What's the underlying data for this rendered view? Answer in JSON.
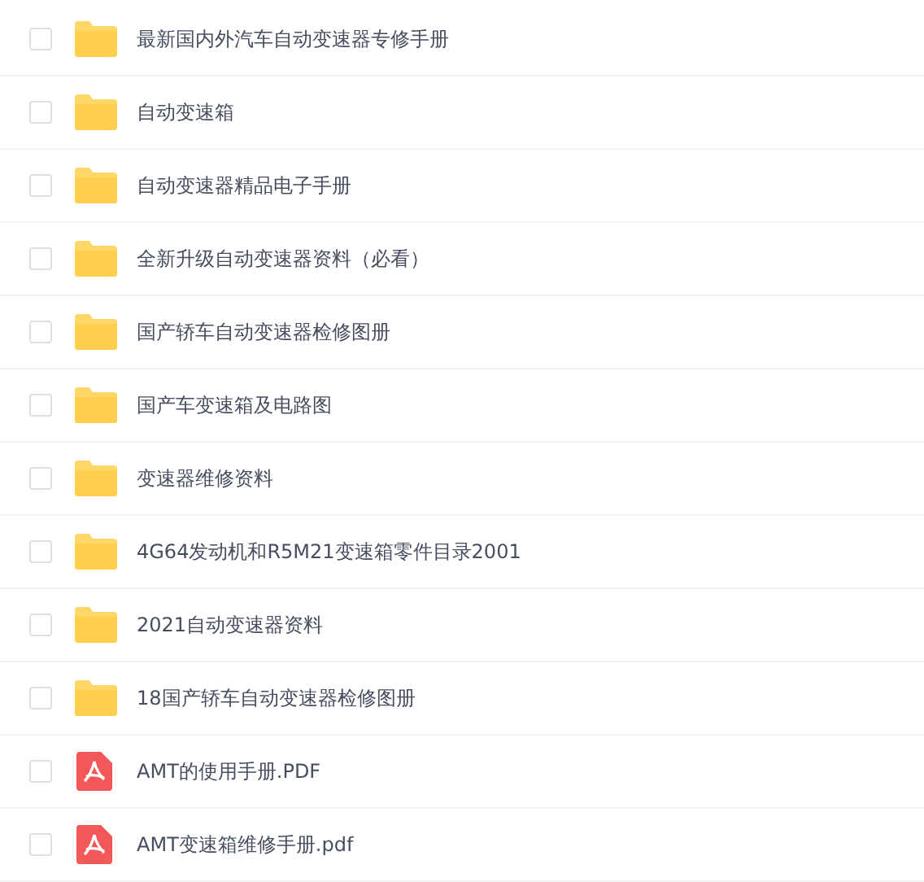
{
  "files": [
    {
      "kind": "folder",
      "name": "最新国内外汽车自动变速器专修手册",
      "checked": false
    },
    {
      "kind": "folder",
      "name": "自动变速箱",
      "checked": false
    },
    {
      "kind": "folder",
      "name": "自动变速器精品电子手册",
      "checked": false
    },
    {
      "kind": "folder",
      "name": "全新升级自动变速器资料（必看）",
      "checked": false
    },
    {
      "kind": "folder",
      "name": "国产轿车自动变速器检修图册",
      "checked": false
    },
    {
      "kind": "folder",
      "name": "国产车变速箱及电路图",
      "checked": false
    },
    {
      "kind": "folder",
      "name": "变速器维修资料",
      "checked": false
    },
    {
      "kind": "folder",
      "name": "4G64发动机和R5M21变速箱零件目录2001",
      "checked": false
    },
    {
      "kind": "folder",
      "name": "2021自动变速器资料",
      "checked": false
    },
    {
      "kind": "folder",
      "name": "18国产轿车自动变速器检修图册",
      "checked": false
    },
    {
      "kind": "pdf",
      "name": "AMT的使用手册.PDF",
      "checked": false
    },
    {
      "kind": "pdf",
      "name": "AMT变速箱维修手册.pdf",
      "checked": false
    }
  ]
}
